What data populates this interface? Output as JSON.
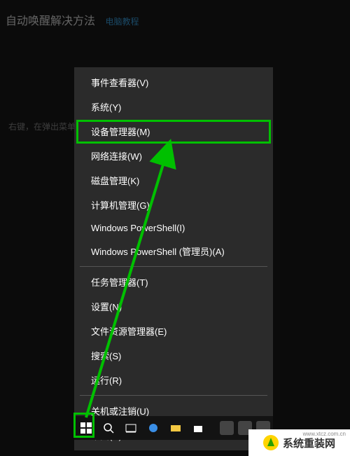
{
  "header": {
    "title": "自动唤醒解决方法",
    "link": "电脑教程"
  },
  "bg_hint": "右键，在弹出菜单",
  "menu": {
    "items_a": [
      "事件查看器(V)",
      "系统(Y)",
      "设备管理器(M)",
      "网络连接(W)",
      "磁盘管理(K)",
      "计算机管理(G)",
      "Windows PowerShell(I)",
      "Windows PowerShell (管理员)(A)"
    ],
    "items_b": [
      "任务管理器(T)",
      "设置(N)",
      "文件资源管理器(E)",
      "搜索(S)",
      "运行(R)"
    ],
    "items_c": [
      "关机或注销(U)",
      "桌面(D)"
    ]
  },
  "watermark": {
    "text": "系统重装网",
    "url": "www.xtcz.com.cn"
  }
}
